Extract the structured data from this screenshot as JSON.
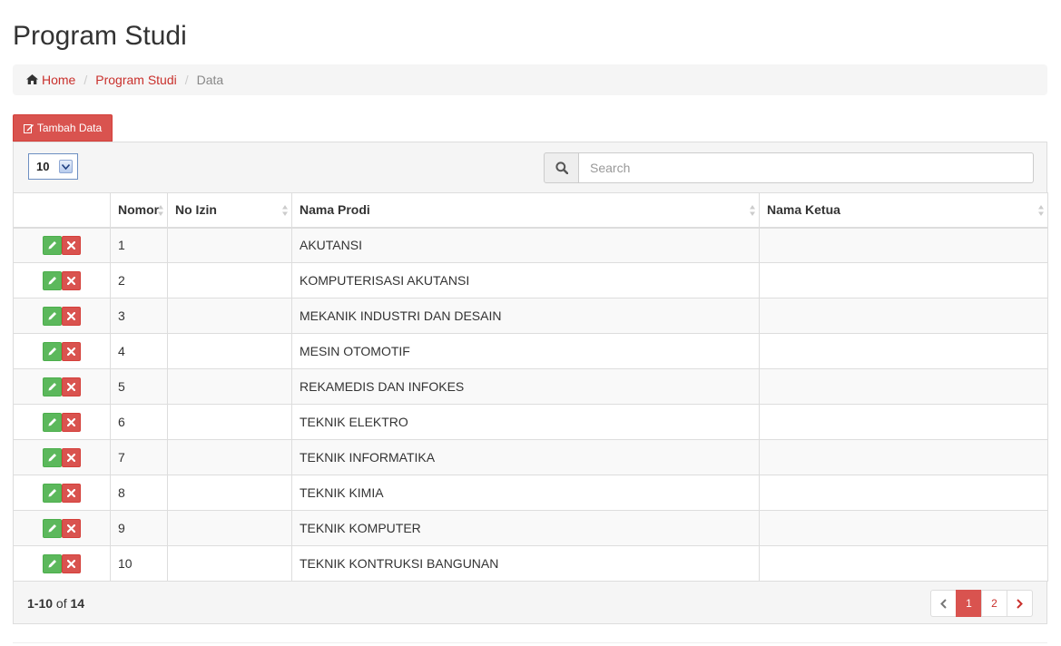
{
  "page": {
    "title": "Program Studi"
  },
  "breadcrumb": {
    "home": "Home",
    "section": "Program Studi",
    "current": "Data"
  },
  "toolbar": {
    "add_label": "Tambah Data",
    "per_page": "10",
    "search_placeholder": "Search"
  },
  "table": {
    "columns": [
      "",
      "Nomor",
      "No Izin",
      "Nama Prodi",
      "Nama Ketua"
    ],
    "rows": [
      {
        "no": "1",
        "izin": "",
        "prodi": "AKUTANSI",
        "ketua": ""
      },
      {
        "no": "2",
        "izin": "",
        "prodi": "KOMPUTERISASI AKUTANSI",
        "ketua": ""
      },
      {
        "no": "3",
        "izin": "",
        "prodi": "MEKANIK INDUSTRI DAN DESAIN",
        "ketua": ""
      },
      {
        "no": "4",
        "izin": "",
        "prodi": "MESIN OTOMOTIF",
        "ketua": ""
      },
      {
        "no": "5",
        "izin": "",
        "prodi": "REKAMEDIS DAN INFOKES",
        "ketua": ""
      },
      {
        "no": "6",
        "izin": "",
        "prodi": "TEKNIK ELEKTRO",
        "ketua": ""
      },
      {
        "no": "7",
        "izin": "",
        "prodi": "TEKNIK INFORMATIKA",
        "ketua": ""
      },
      {
        "no": "8",
        "izin": "",
        "prodi": "TEKNIK KIMIA",
        "ketua": ""
      },
      {
        "no": "9",
        "izin": "",
        "prodi": "TEKNIK KOMPUTER",
        "ketua": ""
      },
      {
        "no": "10",
        "izin": "",
        "prodi": "TEKNIK KONTRUKSI BANGUNAN",
        "ketua": ""
      }
    ]
  },
  "footer": {
    "range": "1-10",
    "of": "of",
    "total": "14"
  },
  "pagination": {
    "pages": [
      "1",
      "2"
    ],
    "active": "1"
  },
  "colors": {
    "accent": "#d9534f",
    "link": "#c9302c",
    "edit": "#5cb85c"
  },
  "icons": [
    "home-icon",
    "edit-icon",
    "search-icon",
    "pencil-icon",
    "close-icon",
    "sort-icon",
    "chevron-left-icon",
    "chevron-right-icon"
  ]
}
